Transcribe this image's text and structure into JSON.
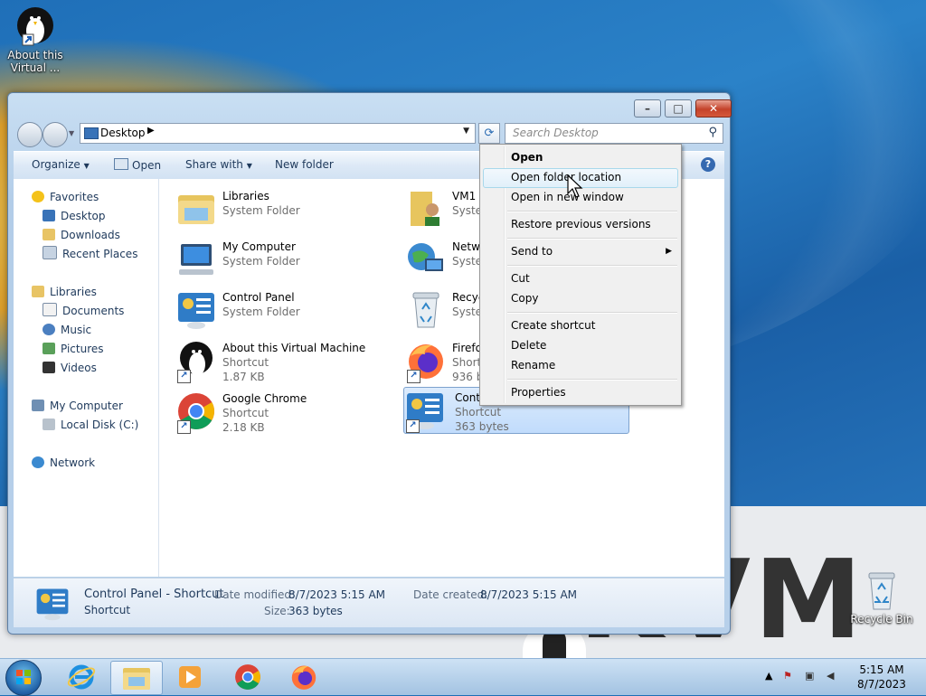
{
  "desktop": {
    "icons": [
      {
        "label_line1": "About this",
        "label_line2": "Virtual ..."
      },
      {
        "label": "Recycle Bin"
      }
    ],
    "watermark": "KVM"
  },
  "window": {
    "address": {
      "location": "Desktop"
    },
    "search": {
      "placeholder": "Search Desktop"
    },
    "toolbar": {
      "organize": "Organize",
      "open": "Open",
      "share_with": "Share with",
      "new_folder": "New folder",
      "help": "?"
    },
    "navigation": {
      "favorites": {
        "label": "Favorites",
        "items": [
          "Desktop",
          "Downloads",
          "Recent Places"
        ]
      },
      "libraries": {
        "label": "Libraries",
        "items": [
          "Documents",
          "Music",
          "Pictures",
          "Videos"
        ]
      },
      "computer": {
        "label": "My Computer",
        "items": [
          "Local Disk (C:)"
        ]
      },
      "network": {
        "label": "Network"
      }
    },
    "items": [
      {
        "name": "Libraries",
        "type": "System Folder",
        "size": ""
      },
      {
        "name": "My Computer",
        "type": "System Folder",
        "size": ""
      },
      {
        "name": "Control Panel",
        "type": "System Folder",
        "size": ""
      },
      {
        "name": "About this Virtual Machine",
        "type": "Shortcut",
        "size": "1.87 KB"
      },
      {
        "name": "Google Chrome",
        "type": "Shortcut",
        "size": "2.18 KB"
      },
      {
        "name": "VM1",
        "type": "Syste",
        "size": ""
      },
      {
        "name": "Netw",
        "type": "Syste",
        "size": ""
      },
      {
        "name": "Recyc",
        "type": "Syste",
        "size": ""
      },
      {
        "name": "Firefo",
        "type": "Short",
        "size": "936 b"
      },
      {
        "name": "Contr",
        "type": "Shortcut",
        "size": "363 bytes"
      }
    ],
    "details": {
      "name": "Control Panel - Shortcut",
      "type": "Shortcut",
      "date_modified_label": "Date modified:",
      "date_modified": "8/7/2023 5:15 AM",
      "date_created_label": "Date created:",
      "date_created": "8/7/2023 5:15 AM",
      "size_label": "Size:",
      "size": "363 bytes"
    }
  },
  "context_menu": {
    "items": [
      "Open",
      "Open folder location",
      "Open in new window",
      "Restore previous versions",
      "Send to",
      "Cut",
      "Copy",
      "Create shortcut",
      "Delete",
      "Rename",
      "Properties"
    ],
    "highlighted": "Open folder location"
  },
  "taskbar": {
    "clock_time": "5:15 AM",
    "clock_date": "8/7/2023"
  },
  "colors": {
    "window_frame": "#b7d0ea",
    "selection": "#c1dcfc",
    "menu_highlight": "#e1f0fa"
  }
}
